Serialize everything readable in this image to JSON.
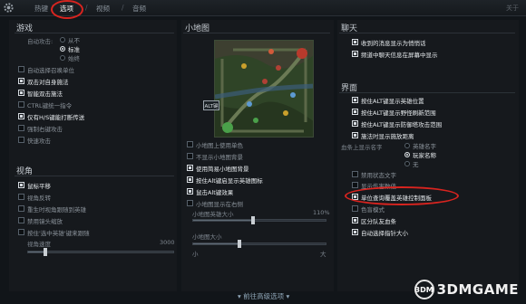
{
  "tabs": [
    {
      "label": "热键"
    },
    {
      "label": "选项"
    },
    {
      "label": "视频"
    },
    {
      "label": "音频"
    }
  ],
  "close_label": "关于",
  "game": {
    "title": "游戏",
    "autocast_label": "自动攻击:",
    "autocast_options": [
      {
        "label": "从不",
        "selected": false
      },
      {
        "label": "标准",
        "selected": true
      },
      {
        "label": "始终",
        "selected": false
      }
    ],
    "checkboxes": [
      {
        "label": "自动选择召唤单位",
        "checked": false
      },
      {
        "label": "双击对自身施法",
        "checked": true
      },
      {
        "label": "智能双击施法",
        "checked": true
      },
      {
        "label": "CTRL键统一指令",
        "checked": false
      },
      {
        "label": "仅有H/S键能打断传送",
        "checked": true
      },
      {
        "label": "强制右键攻击",
        "checked": false
      },
      {
        "label": "快速攻击",
        "checked": false
      }
    ]
  },
  "view": {
    "title": "视角",
    "checkboxes": [
      {
        "label": "鼠标平移",
        "checked": true
      },
      {
        "label": "视角反转",
        "checked": false
      },
      {
        "label": "重生时视角跟随到英雄",
        "checked": false
      },
      {
        "label": "禁用镜头缩放",
        "checked": false
      },
      {
        "label": "按住'选中英雄'键来跟随",
        "checked": false
      }
    ],
    "speed_label": "视角速度",
    "speed_max": "3000",
    "speed_value": 0.12
  },
  "minimap": {
    "title": "小地图",
    "alt_label": "ALT键",
    "checkboxes": [
      {
        "label": "小地图上使用单色",
        "checked": false
      },
      {
        "label": "不显示小地图背景",
        "checked": false
      },
      {
        "label": "使用简易小地图背景",
        "checked": true
      },
      {
        "label": "按住Alt键启显示英雄图标",
        "checked": true
      },
      {
        "label": "鼠击Alt键效果",
        "checked": true
      },
      {
        "label": "小地图显示在右侧",
        "checked": false
      }
    ],
    "hero_size_label": "小地图英雄大小",
    "hero_size_max": "110%",
    "hero_size_value": 0.45,
    "map_size_label": "小地图大小",
    "map_size_min": "小",
    "map_size_max": "大",
    "map_size_value": 0.35
  },
  "chat": {
    "title": "聊天",
    "checkboxes": [
      {
        "label": "收到的消息显示为悄悄话",
        "checked": true
      },
      {
        "label": "频道中聊天信息在屏幕中显示",
        "checked": true
      }
    ]
  },
  "interface": {
    "title": "界面",
    "checkboxes": [
      {
        "label": "按住ALT键显示英雄位置",
        "checked": true
      },
      {
        "label": "按住ALT键显示野怪刷新范围",
        "checked": true
      },
      {
        "label": "按住ALT键显示防御塔攻击范围",
        "checked": true
      },
      {
        "label": "施法时显示施放距离",
        "checked": true
      }
    ],
    "name_display_label": "血条上显示名字",
    "name_options": [
      {
        "label": "英雄名字",
        "selected": false
      },
      {
        "label": "玩家名称",
        "selected": true
      },
      {
        "label": "无",
        "selected": false
      }
    ],
    "more_checkboxes": [
      {
        "label": "禁用状态文字",
        "checked": false
      },
      {
        "label": "显示伤害数值",
        "checked": false
      },
      {
        "label": "单位查询覆盖英雄控制面板",
        "checked": true
      },
      {
        "label": "色盲模式",
        "checked": false
      },
      {
        "label": "区分队友血条",
        "checked": true
      },
      {
        "label": "自动选择指针大小",
        "checked": true
      }
    ]
  },
  "bottom_link": "▾ 前往高级选项 ▾",
  "watermark": {
    "circle": "3DM",
    "text": "3DMGAME"
  },
  "colors": {
    "highlight": "#d9241f",
    "background": "#111519"
  }
}
